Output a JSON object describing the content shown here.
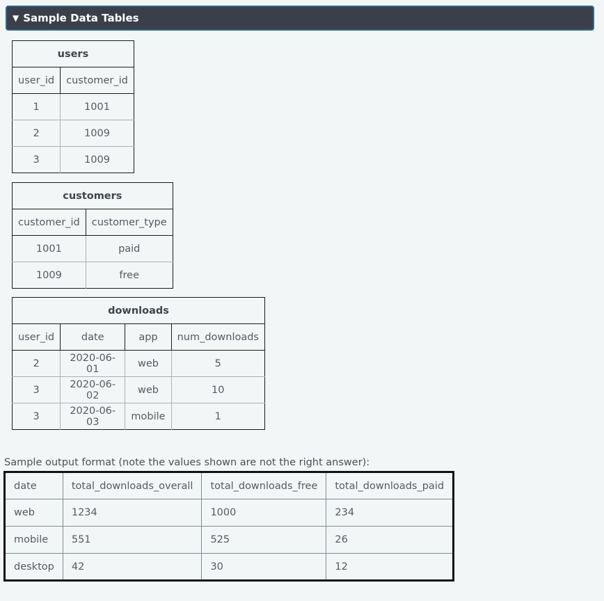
{
  "section": {
    "toggle_icon": "triangle-down-icon",
    "toggle_glyph": "▼",
    "title": "Sample Data Tables"
  },
  "tables": {
    "users": {
      "title": "users",
      "columns": [
        "user_id",
        "customer_id"
      ],
      "rows": [
        [
          "1",
          "1001"
        ],
        [
          "2",
          "1009"
        ],
        [
          "3",
          "1009"
        ]
      ]
    },
    "customers": {
      "title": "customers",
      "columns": [
        "customer_id",
        "customer_type"
      ],
      "rows": [
        [
          "1001",
          "paid"
        ],
        [
          "1009",
          "free"
        ]
      ]
    },
    "downloads": {
      "title": "downloads",
      "columns": [
        "user_id",
        "date",
        "app",
        "num_downloads"
      ],
      "rows": [
        [
          "2",
          "2020-06-01",
          "web",
          "5"
        ],
        [
          "3",
          "2020-06-02",
          "web",
          "10"
        ],
        [
          "3",
          "2020-06-03",
          "mobile",
          "1"
        ]
      ]
    }
  },
  "output": {
    "caption": "Sample output format (note the values shown are not the right answer):",
    "columns": [
      "date",
      "total_downloads_overall",
      "total_downloads_free",
      "total_downloads_paid"
    ],
    "rows": [
      [
        "web",
        "1234",
        "1000",
        "234"
      ],
      [
        "mobile",
        "551",
        "525",
        "26"
      ],
      [
        "desktop",
        "42",
        "30",
        "12"
      ]
    ]
  }
}
